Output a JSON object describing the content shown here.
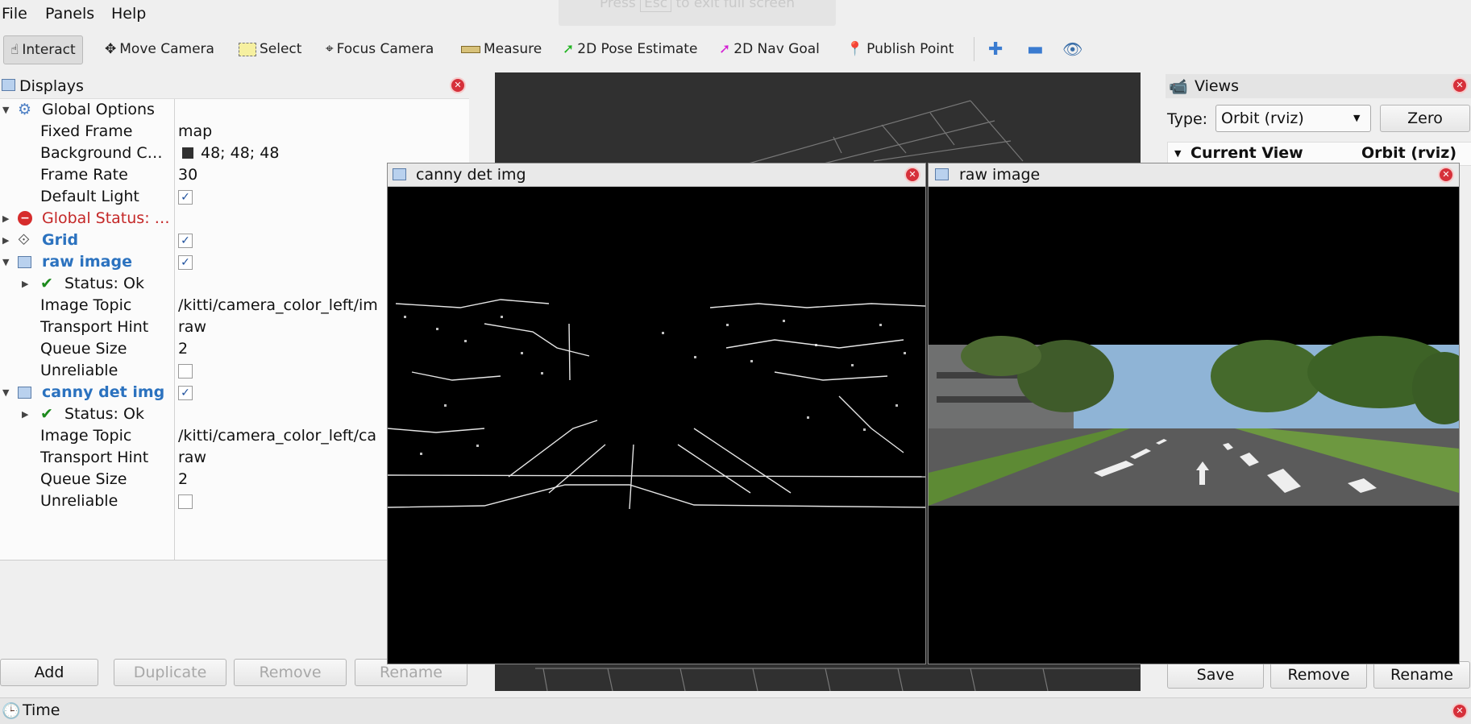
{
  "menu": {
    "file": "File",
    "panels": "Panels",
    "help": "Help"
  },
  "fullscreen_hint": {
    "press": "Press",
    "key": "Esc",
    "text": "to exit full screen"
  },
  "toolbar": {
    "interact": "Interact",
    "move_camera": "Move Camera",
    "select": "Select",
    "focus_camera": "Focus Camera",
    "measure": "Measure",
    "pose_estimate": "2D Pose Estimate",
    "nav_goal": "2D Nav Goal",
    "publish_point": "Publish Point"
  },
  "displays": {
    "title": "Displays",
    "global_options": "Global Options",
    "fixed_frame_label": "Fixed Frame",
    "fixed_frame_value": "map",
    "background_label": "Background C…",
    "background_value": "48; 48; 48",
    "frame_rate_label": "Frame Rate",
    "frame_rate_value": "30",
    "default_light_label": "Default Light",
    "global_status": "Global Status: …",
    "grid": "Grid",
    "raw_image": "raw image",
    "status_ok": "Status: Ok",
    "image_topic_label": "Image Topic",
    "raw_topic_value": "/kitti/camera_color_left/im",
    "transport_label": "Transport Hint",
    "transport_value": "raw",
    "queue_label": "Queue Size",
    "queue_value": "2",
    "unreliable_label": "Unreliable",
    "canny": "canny det img",
    "canny_topic_value": "/kitti/camera_color_left/ca",
    "buttons": {
      "add": "Add",
      "duplicate": "Duplicate",
      "remove": "Remove",
      "rename": "Rename"
    }
  },
  "windows": {
    "canny_title": "canny det img",
    "raw_title": "raw image"
  },
  "views": {
    "title": "Views",
    "type_label": "Type:",
    "type_value": "Orbit (rviz)",
    "zero": "Zero",
    "current_view": "Current View",
    "current_view_type": "Orbit (rviz)",
    "buttons": {
      "save": "Save",
      "remove": "Remove",
      "rename": "Rename"
    }
  },
  "time": {
    "title": "Time"
  },
  "colors": {
    "accent_blue": "#2b72bf",
    "error_red": "#c42727",
    "viewport_bg": "#303030"
  }
}
